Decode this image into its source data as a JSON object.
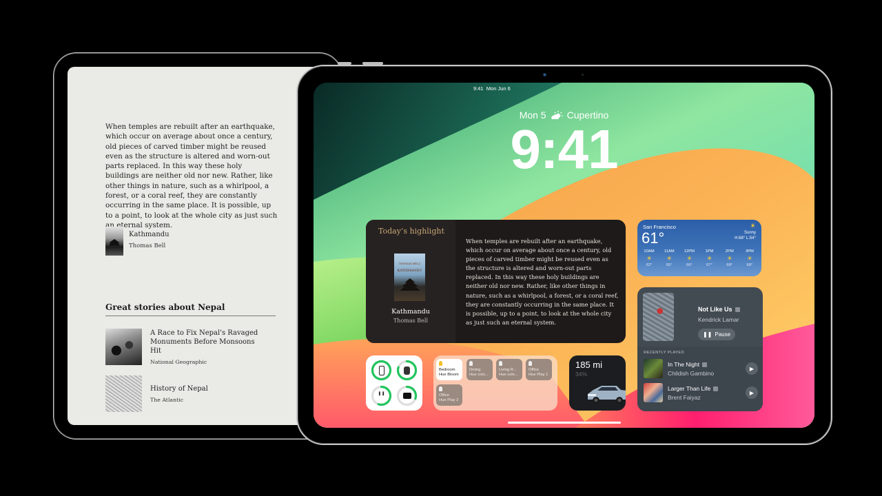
{
  "reader": {
    "excerpt": "When temples are rebuilt after an earthquake, which occur on average about once a century, old pieces of carved timber might be reused even as the structure is altered and worn-out parts replaced. In this way these holy buildings are neither old nor new. Rather, like other things in nature, such as a whirlpool, a forest, or a coral reef, they are constantly occurring in the same place. It is possible, up to a point, to look at the whole city as just such an eternal system.",
    "book": {
      "title": "Kathmandu",
      "author": "Thomas Bell"
    },
    "stories_heading": "Great stories about Nepal",
    "stories": [
      {
        "title": "A Race to Fix Nepal's Ravaged Monuments Before Monsoons Hit",
        "source": "National Geographic"
      },
      {
        "title": "History of Nepal",
        "source": "The Atlantic"
      }
    ]
  },
  "lock_screen": {
    "status_time": "9:41",
    "status_date": "Mon Jun 6",
    "date_line": "Mon 5",
    "weather_icon": "partly-sunny-icon",
    "location": "Cupertino",
    "time": "9:41"
  },
  "highlight_widget": {
    "heading": "Today’s highlight",
    "cover_author": "THOMAS BELL",
    "cover_title": "KATHMANDU",
    "book_title": "Kathmandu",
    "book_author": "Thomas Bell",
    "excerpt": "When temples are rebuilt after an earthquake, which occur on average about once a century, old pieces of carved timber might be reused even as the structure is altered and worn-out parts replaced. In this way these holy buildings are neither old nor new. Rather, like other things in nature, such as a whirlpool, a forest, or a coral reef, they are constantly occurring in the same place. It is possible, up to a point, to look at the whole city as just such an eternal system."
  },
  "weather_widget": {
    "city": "San Francisco",
    "temp": "61°",
    "condition": "Sunny",
    "hi_lo": "H:68° L:54°",
    "icon": "sun-icon",
    "hours": [
      {
        "time": "10AM",
        "temp": "62°"
      },
      {
        "time": "11AM",
        "temp": "65°"
      },
      {
        "time": "12PM",
        "temp": "66°"
      },
      {
        "time": "1PM",
        "temp": "67°"
      },
      {
        "time": "2PM",
        "temp": "68°"
      },
      {
        "time": "3PM",
        "temp": "68°"
      }
    ]
  },
  "music_widget": {
    "now_playing": {
      "title": "Not Like Us",
      "artist": "Kendrick Lamar",
      "explicit": true
    },
    "pause_label": "Pause",
    "recent_label": "RECENTLY PLAYED",
    "recent": [
      {
        "title": "In The Night",
        "artist": "Childish Gambino",
        "explicit": true
      },
      {
        "title": "Larger Than Life",
        "artist": "Brent Faiyaz",
        "explicit": true
      }
    ]
  },
  "battery_widget": {
    "devices": [
      {
        "name": "iPhone",
        "icon": "phone-icon",
        "level": 1.0
      },
      {
        "name": "Watch",
        "icon": "watch-icon",
        "level": 0.8
      },
      {
        "name": "AirPods",
        "icon": "airpods-icon",
        "level": 0.55
      },
      {
        "name": "AirPods Case",
        "icon": "case-icon",
        "level": 0.3
      }
    ],
    "ring_color": "#22c55e"
  },
  "home_widget": {
    "lights": [
      {
        "room": "Bedroom",
        "device": "Hue Bloom",
        "on": true
      },
      {
        "room": "Dining",
        "device": "Hue colo...",
        "on": false
      },
      {
        "room": "Living R...",
        "device": "Hue colo...",
        "on": false
      },
      {
        "room": "Office",
        "device": "Hue Play 1",
        "on": false
      },
      {
        "room": "Office",
        "device": "Hue Play 2",
        "on": false
      }
    ]
  },
  "car_widget": {
    "range": "185 mi",
    "charge": "34%"
  }
}
